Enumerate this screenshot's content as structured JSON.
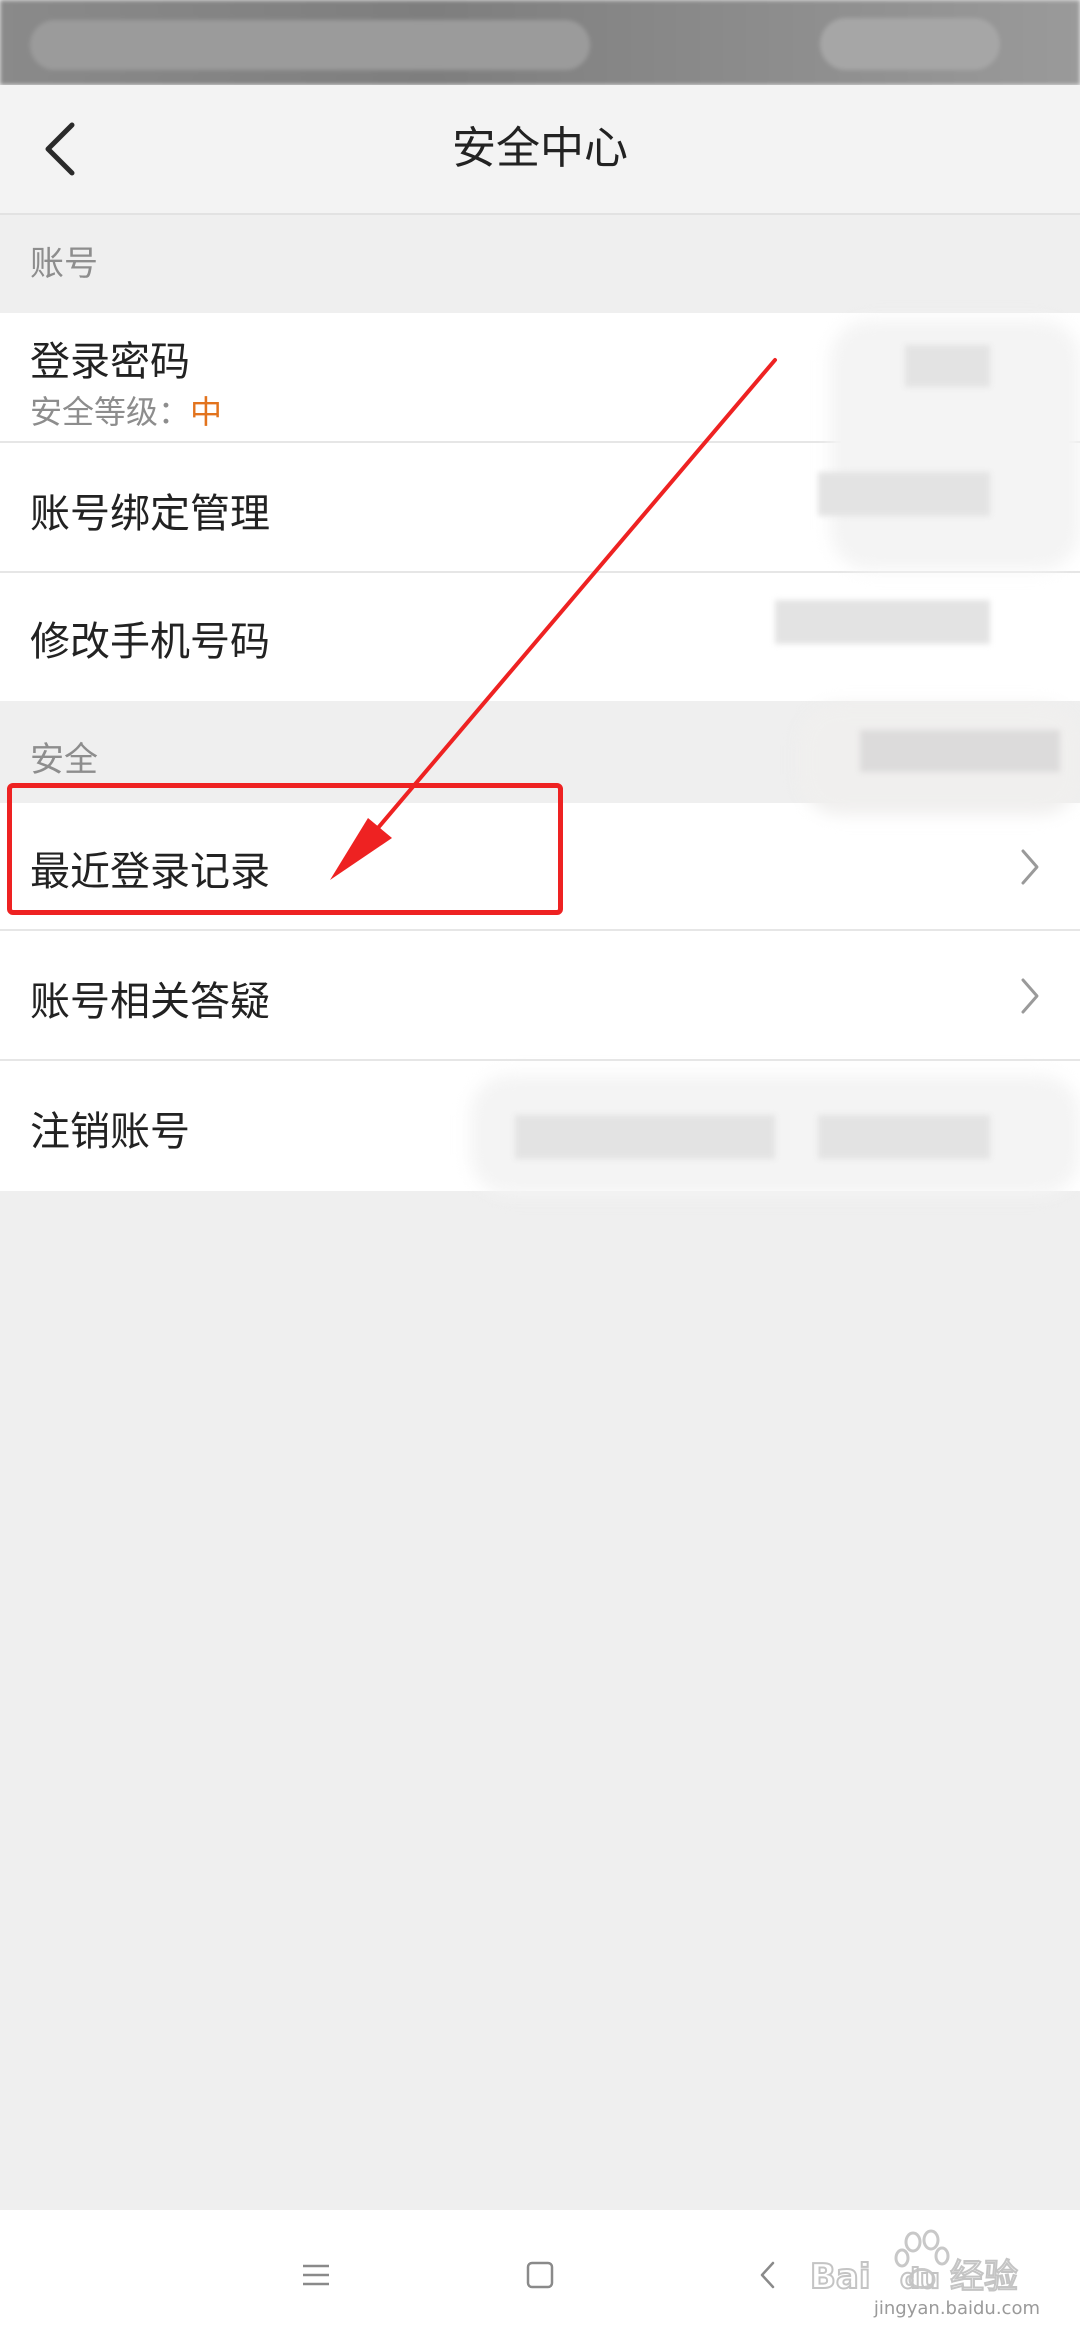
{
  "header": {
    "title": "安全中心"
  },
  "sections": [
    {
      "title": "账号",
      "items": [
        {
          "label": "登录密码",
          "sub_label": "安全等级：",
          "sub_value": "中"
        },
        {
          "label": "账号绑定管理"
        },
        {
          "label": "修改手机号码"
        }
      ]
    },
    {
      "title": "安全",
      "items": [
        {
          "label": "最近登录记录"
        },
        {
          "label": "账号相关答疑"
        },
        {
          "label": "注销账号"
        }
      ]
    }
  ],
  "colors": {
    "level_medium": "#e2731d",
    "annotation": "#ee2222"
  },
  "watermark": {
    "logo_text": "Baidu经验",
    "url": "jingyan.baidu.com"
  },
  "icons": {
    "back": "chevron-left-icon",
    "row_arrow": "chevron-right-icon",
    "nav_menu": "menu-icon",
    "nav_home": "square-icon",
    "nav_back": "triangle-left-icon"
  }
}
